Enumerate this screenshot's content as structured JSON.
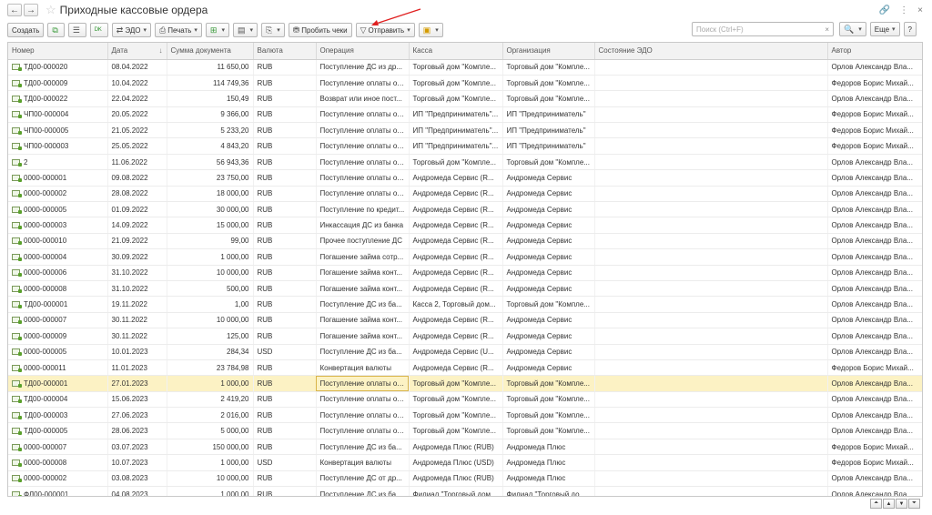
{
  "title": "Приходные кассовые ордера",
  "toolbar": {
    "create": "Создать",
    "edo": "ЭДО",
    "print": "Печать",
    "print_checks": "Пробить чеки",
    "send": "Отправить",
    "search_placeholder": "Поиск (Ctrl+F)",
    "more": "Еще",
    "help": "?"
  },
  "columns": [
    "Номер",
    "Дата",
    "Сумма документа",
    "Валюта",
    "Операция",
    "Касса",
    "Организация",
    "Состояние ЭДО",
    "Автор"
  ],
  "rows": [
    [
      "ТД00-000020",
      "08.04.2022",
      "11 650,00",
      "RUB",
      "Поступление ДС из др...",
      "Торговый дом \"Компле...",
      "Торговый дом \"Компле...",
      "",
      "Орлов Александр Вла..."
    ],
    [
      "ТД00-000009",
      "10.04.2022",
      "114 749,36",
      "RUB",
      "Поступление оплаты от...",
      "Торговый дом \"Компле...",
      "Торговый дом \"Компле...",
      "",
      "Федоров Борис Михай..."
    ],
    [
      "ТД00-000022",
      "22.04.2022",
      "150,49",
      "RUB",
      "Возврат или иное пост...",
      "Торговый дом \"Компле...",
      "Торговый дом \"Компле...",
      "",
      "Орлов Александр Вла..."
    ],
    [
      "ЧП00-000004",
      "20.05.2022",
      "9 366,00",
      "RUB",
      "Поступление оплаты от...",
      "ИП \"Предприниматель\"...",
      "ИП \"Предприниматель\"",
      "",
      "Федоров Борис Михай..."
    ],
    [
      "ЧП00-000005",
      "21.05.2022",
      "5 233,20",
      "RUB",
      "Поступление оплаты от...",
      "ИП \"Предприниматель\"...",
      "ИП \"Предприниматель\"",
      "",
      "Федоров Борис Михай..."
    ],
    [
      "ЧП00-000003",
      "25.05.2022",
      "4 843,20",
      "RUB",
      "Поступление оплаты от...",
      "ИП \"Предприниматель\"...",
      "ИП \"Предприниматель\"",
      "",
      "Федоров Борис Михай..."
    ],
    [
      "2",
      "11.06.2022",
      "56 943,36",
      "RUB",
      "Поступление оплаты от...",
      "Торговый дом \"Компле...",
      "Торговый дом \"Компле...",
      "",
      "Орлов Александр Вла..."
    ],
    [
      "0000-000001",
      "09.08.2022",
      "23 750,00",
      "RUB",
      "Поступление оплаты от...",
      "Андромеда Сервис (R...",
      "Андромеда Сервис",
      "",
      "Орлов Александр Вла..."
    ],
    [
      "0000-000002",
      "28.08.2022",
      "18 000,00",
      "RUB",
      "Поступление оплаты от...",
      "Андромеда Сервис (R...",
      "Андромеда Сервис",
      "",
      "Орлов Александр Вла..."
    ],
    [
      "0000-000005",
      "01.09.2022",
      "30 000,00",
      "RUB",
      "Поступление по кредит...",
      "Андромеда Сервис (R...",
      "Андромеда Сервис",
      "",
      "Орлов Александр Вла..."
    ],
    [
      "0000-000003",
      "14.09.2022",
      "15 000,00",
      "RUB",
      "Инкассация ДС из банка",
      "Андромеда Сервис (R...",
      "Андромеда Сервис",
      "",
      "Орлов Александр Вла..."
    ],
    [
      "0000-000010",
      "21.09.2022",
      "99,00",
      "RUB",
      "Прочее поступление ДС",
      "Андромеда Сервис (R...",
      "Андромеда Сервис",
      "",
      "Орлов Александр Вла..."
    ],
    [
      "0000-000004",
      "30.09.2022",
      "1 000,00",
      "RUB",
      "Погашение займа сотр...",
      "Андромеда Сервис (R...",
      "Андромеда Сервис",
      "",
      "Орлов Александр Вла..."
    ],
    [
      "0000-000006",
      "31.10.2022",
      "10 000,00",
      "RUB",
      "Погашение займа конт...",
      "Андромеда Сервис (R...",
      "Андромеда Сервис",
      "",
      "Орлов Александр Вла..."
    ],
    [
      "0000-000008",
      "31.10.2022",
      "500,00",
      "RUB",
      "Погашение займа конт...",
      "Андромеда Сервис (R...",
      "Андромеда Сервис",
      "",
      "Орлов Александр Вла..."
    ],
    [
      "ТД00-000001",
      "19.11.2022",
      "1,00",
      "RUB",
      "Поступление ДС из ба...",
      "Касса 2, Торговый дом...",
      "Торговый дом \"Компле...",
      "",
      "Орлов Александр Вла..."
    ],
    [
      "0000-000007",
      "30.11.2022",
      "10 000,00",
      "RUB",
      "Погашение займа конт...",
      "Андромеда Сервис (R...",
      "Андромеда Сервис",
      "",
      "Орлов Александр Вла..."
    ],
    [
      "0000-000009",
      "30.11.2022",
      "125,00",
      "RUB",
      "Погашение займа конт...",
      "Андромеда Сервис (R...",
      "Андромеда Сервис",
      "",
      "Орлов Александр Вла..."
    ],
    [
      "0000-000005",
      "10.01.2023",
      "284,34",
      "USD",
      "Поступление ДС из ба...",
      "Андромеда Сервис (U...",
      "Андромеда Сервис",
      "",
      "Орлов Александр Вла..."
    ],
    [
      "0000-000011",
      "11.01.2023",
      "23 784,98",
      "RUB",
      "Конвертация валюты",
      "Андромеда Сервис (R...",
      "Андромеда Сервис",
      "",
      "Федоров Борис Михай..."
    ],
    [
      "ТД00-000001",
      "27.01.2023",
      "1 000,00",
      "RUB",
      "Поступление оплаты от...",
      "Торговый дом \"Компле...",
      "Торговый дом \"Компле...",
      "",
      "Орлов Александр Вла..."
    ],
    [
      "ТД00-000004",
      "15.06.2023",
      "2 419,20",
      "RUB",
      "Поступление оплаты от...",
      "Торговый дом \"Компле...",
      "Торговый дом \"Компле...",
      "",
      "Орлов Александр Вла..."
    ],
    [
      "ТД00-000003",
      "27.06.2023",
      "2 016,00",
      "RUB",
      "Поступление оплаты от...",
      "Торговый дом \"Компле...",
      "Торговый дом \"Компле...",
      "",
      "Орлов Александр Вла..."
    ],
    [
      "ТД00-000005",
      "28.06.2023",
      "5 000,00",
      "RUB",
      "Поступление оплаты от...",
      "Торговый дом \"Компле...",
      "Торговый дом \"Компле...",
      "",
      "Орлов Александр Вла..."
    ],
    [
      "0000-000007",
      "03.07.2023",
      "150 000,00",
      "RUB",
      "Поступление ДС из ба...",
      "Андромеда Плюс (RUB)",
      "Андромеда Плюс",
      "",
      "Федоров Борис Михай..."
    ],
    [
      "0000-000008",
      "10.07.2023",
      "1 000,00",
      "USD",
      "Конвертация валюты",
      "Андромеда Плюс (USD)",
      "Андромеда Плюс",
      "",
      "Федоров Борис Михай..."
    ],
    [
      "0000-000002",
      "03.08.2023",
      "10 000,00",
      "RUB",
      "Поступление ДС от др...",
      "Андромеда Плюс (RUB)",
      "Андромеда Плюс",
      "",
      "Орлов Александр Вла..."
    ],
    [
      "ФЛ00-000001",
      "04.08.2023",
      "1 000,00",
      "RUB",
      "Поступление ДС из ба...",
      "Филиал \"Торговый дом...",
      "Филиал \"Торговый дом...",
      "",
      "Орлов Александр Вла..."
    ]
  ],
  "selected_row": 20,
  "colors": {
    "selected": "#fcf2c4",
    "accent": "#e02020"
  }
}
